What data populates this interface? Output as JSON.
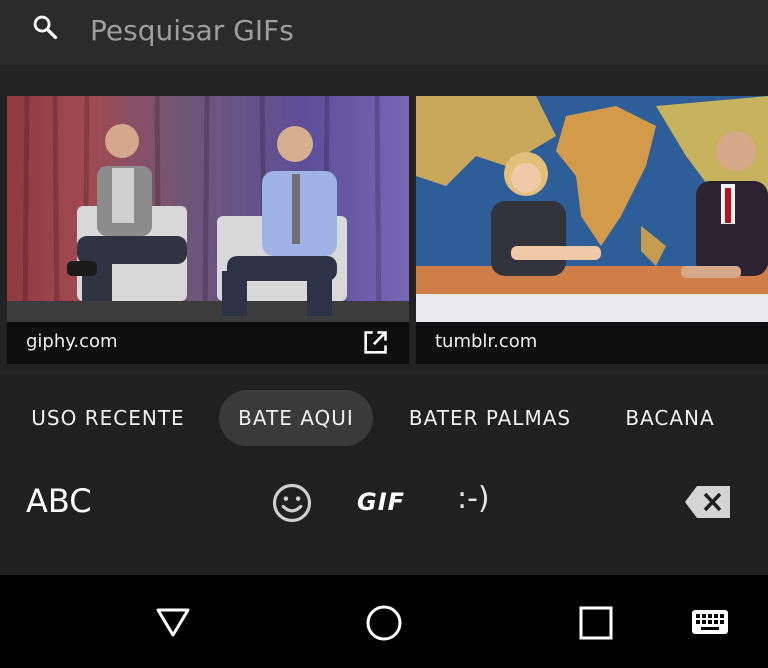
{
  "search": {
    "placeholder": "Pesquisar GIFs",
    "icon": "search-icon"
  },
  "results": [
    {
      "source": "giphy.com",
      "has_open_link": true,
      "image": "two men seated in chairs on stage with purple curtain"
    },
    {
      "source": "tumblr.com",
      "has_open_link": false,
      "image": "two news anchors at desk with world map behind"
    }
  ],
  "categories": [
    {
      "label": "USO RECENTE",
      "active": false
    },
    {
      "label": "BATE AQUI",
      "active": true
    },
    {
      "label": "BATER PALMAS",
      "active": false
    },
    {
      "label": "BACANA",
      "active": false
    }
  ],
  "keyboard": {
    "abc_label": "ABC",
    "gif_label": "GIF",
    "emoticon_label": ":-)",
    "emoji_icon": "emoji-smiley-icon",
    "backspace_icon": "backspace-icon"
  },
  "nav": {
    "back_icon": "back-triangle-icon",
    "home_icon": "home-circle-icon",
    "recents_icon": "recents-square-icon",
    "keyboard_icon": "keyboard-switch-icon"
  },
  "colors": {
    "background": "#202020",
    "search_bar": "#2b2b2b",
    "caption": "#0e0e0e",
    "chip_active": "#3a3a3a",
    "nav_bar": "#000000"
  }
}
